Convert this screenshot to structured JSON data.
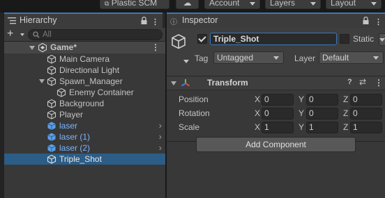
{
  "toolbar": {
    "plastic_scm": "Plastic SCM",
    "account": "Account",
    "layers": "Layers",
    "layout": "Layout"
  },
  "hierarchy": {
    "tab_label": "Hierarchy",
    "search_placeholder": "All",
    "scene_name": "Game*",
    "items": [
      {
        "label": "Main Camera",
        "prefab": false
      },
      {
        "label": "Directional Light",
        "prefab": false
      },
      {
        "label": "Spawn_Manager",
        "prefab": false,
        "expanded": true
      },
      {
        "label": "Enemy Container",
        "prefab": false
      },
      {
        "label": "Background",
        "prefab": false
      },
      {
        "label": "Player",
        "prefab": false
      },
      {
        "label": "laser",
        "prefab": true
      },
      {
        "label": "laser (1)",
        "prefab": true
      },
      {
        "label": "laser (2)",
        "prefab": true
      },
      {
        "label": "Triple_Shot",
        "prefab": false,
        "selected": true
      }
    ]
  },
  "inspector": {
    "tab_label": "Inspector",
    "object_name": "Triple_Shot",
    "active": true,
    "static_label": "Static",
    "static_checked": false,
    "tag_label": "Tag",
    "tag_value": "Untagged",
    "layer_label": "Layer",
    "layer_value": "Default",
    "transform": {
      "title": "Transform",
      "axis_x": "X",
      "axis_y": "Y",
      "axis_z": "Z",
      "position": {
        "label": "Position",
        "x": "0",
        "y": "0",
        "z": "0"
      },
      "rotation": {
        "label": "Rotation",
        "x": "0",
        "y": "0",
        "z": "0"
      },
      "scale": {
        "label": "Scale",
        "x": "1",
        "y": "1",
        "z": "1"
      }
    },
    "add_component": "Add Component"
  },
  "colors": {
    "selection": "#2c5d87",
    "prefab_text": "#7ab4ff",
    "focus_outline": "#3a79bb"
  }
}
